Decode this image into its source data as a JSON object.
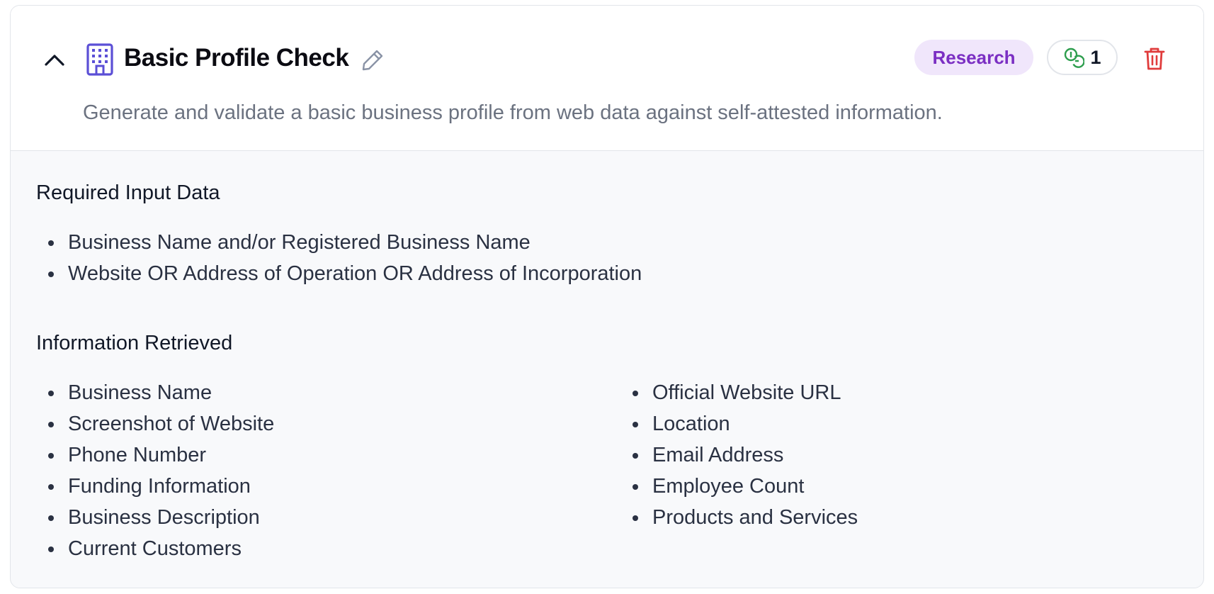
{
  "card": {
    "title": "Basic Profile Check",
    "description": "Generate and validate a basic business profile from web data against self-attested information.",
    "category_badge": "Research",
    "count_badge": "1",
    "icons": {
      "collapse": "chevron-up-icon",
      "category": "building-icon",
      "edit": "pencil-icon",
      "count": "coins-icon",
      "delete": "trash-icon"
    },
    "colors": {
      "building_icon": "#5b4fd6",
      "research_badge_bg": "#f0e6fb",
      "research_badge_text": "#7b2fc3",
      "coins_icon": "#2e9e4e",
      "trash_icon": "#e03c3c"
    }
  },
  "required_input": {
    "heading": "Required Input Data",
    "items": [
      "Business Name and/or Registered Business Name",
      "Website OR Address of Operation OR Address of Incorporation"
    ]
  },
  "information_retrieved": {
    "heading": "Information Retrieved",
    "left_items": [
      "Business Name",
      "Screenshot of Website",
      "Phone Number",
      "Funding Information",
      "Business Description",
      "Current Customers"
    ],
    "right_items": [
      "Official Website URL",
      "Location",
      "Email Address",
      "Employee Count",
      "Products and Services"
    ]
  }
}
